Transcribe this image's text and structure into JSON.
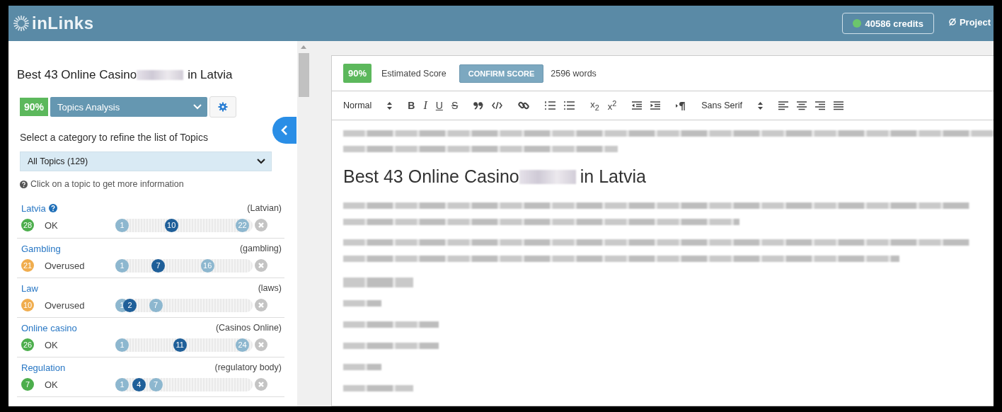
{
  "header": {
    "logo": "inLinks",
    "credits": "40586 credits",
    "project": "Project"
  },
  "sidebar": {
    "title_start": "Best 43 Online Casino",
    "title_end": "in Latvia",
    "score": "90%",
    "analysis_select": "Topics Analysis",
    "category_prompt": "Select a category to refine the list of Topics",
    "category_select": "All Topics (129)",
    "hint": "Click on a topic to get more information",
    "topics": [
      {
        "name": "Latvia",
        "help": true,
        "synonym": "(Latvian)",
        "count": "28",
        "color": "#4cae4c",
        "status": "OK",
        "markers": [
          {
            "label": "1",
            "kind": "min",
            "level": 0
          },
          {
            "label": "10",
            "kind": "current",
            "level": 0.41
          },
          {
            "label": "22",
            "kind": "max",
            "level": 1
          }
        ]
      },
      {
        "name": "Gambling",
        "help": false,
        "synonym": "(gambling)",
        "count": "21",
        "color": "#f0ad4e",
        "status": "Overused",
        "markers": [
          {
            "label": "1",
            "kind": "min",
            "level": 0
          },
          {
            "label": "7",
            "kind": "current",
            "level": 0.3
          },
          {
            "label": "16",
            "kind": "max",
            "level": 0.71
          }
        ]
      },
      {
        "name": "Law",
        "help": false,
        "synonym": "(laws)",
        "count": "10",
        "color": "#f0ad4e",
        "status": "Overused",
        "markers": [
          {
            "label": "1",
            "kind": "min",
            "level": 0
          },
          {
            "label": "2",
            "kind": "current",
            "level": 0.065
          },
          {
            "label": "7",
            "kind": "max",
            "level": 0.28
          }
        ]
      },
      {
        "name": "Online casino",
        "help": false,
        "synonym": "(Casinos Online)",
        "count": "26",
        "color": "#4cae4c",
        "status": "OK",
        "markers": [
          {
            "label": "1",
            "kind": "min",
            "level": 0
          },
          {
            "label": "11",
            "kind": "current",
            "level": 0.48
          },
          {
            "label": "24",
            "kind": "max",
            "level": 1
          }
        ]
      },
      {
        "name": "Regulation",
        "help": false,
        "synonym": "(regulatory body)",
        "count": "7",
        "color": "#4cae4c",
        "status": "OK",
        "markers": [
          {
            "label": "1",
            "kind": "min",
            "level": 0
          },
          {
            "label": "4",
            "kind": "current",
            "level": 0.14
          },
          {
            "label": "7",
            "kind": "max",
            "level": 0.28
          }
        ]
      }
    ]
  },
  "editor": {
    "score": "90%",
    "score_label": "Estimated Score",
    "confirm_button": "CONFIRM SCORE",
    "word_count": "2596 words",
    "format_select": "Normal",
    "marks": [
      "B",
      "I",
      "U",
      "S"
    ],
    "scripts": [
      "x$_{2}$",
      "x$^{2}$"
    ],
    "font_select": "Sans Serif",
    "heading_start": "Best 43 Online Casino",
    "heading_end": "in Latvia"
  }
}
